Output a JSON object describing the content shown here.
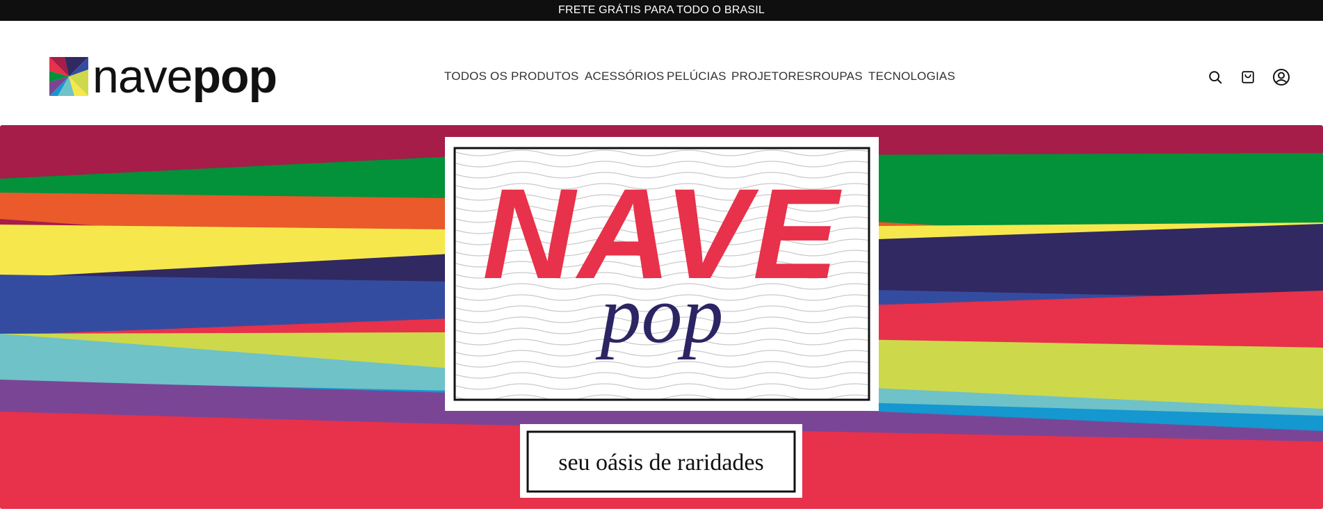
{
  "announcement": {
    "text": "FRETE GRÁTIS PARA TODO O BRASIL"
  },
  "logo": {
    "light": "nave",
    "bold": "pop"
  },
  "nav": {
    "items": [
      {
        "label": "TODOS OS PRODUTOS"
      },
      {
        "label": "ACESSÓRIOS"
      },
      {
        "label": "PELÚCIAS"
      },
      {
        "label": "PROJETORES"
      },
      {
        "label": "ROUPAS"
      },
      {
        "label": "TECNOLOGIAS"
      }
    ]
  },
  "header_icons": [
    "search-icon",
    "cart-icon",
    "account-icon"
  ],
  "hero": {
    "title": "NAVE",
    "subtitle": "pop",
    "tagline": "seu oásis de raridades",
    "colors": {
      "title": "#e8314a",
      "subtitle": "#2c2563",
      "stripes": [
        "#a51d48",
        "#039139",
        "#ea5a2a",
        "#f6e84c",
        "#312962",
        "#344ca0",
        "#e8314a",
        "#cdd94b",
        "#6fc2c8",
        "#1597d0",
        "#7b4595"
      ]
    }
  }
}
